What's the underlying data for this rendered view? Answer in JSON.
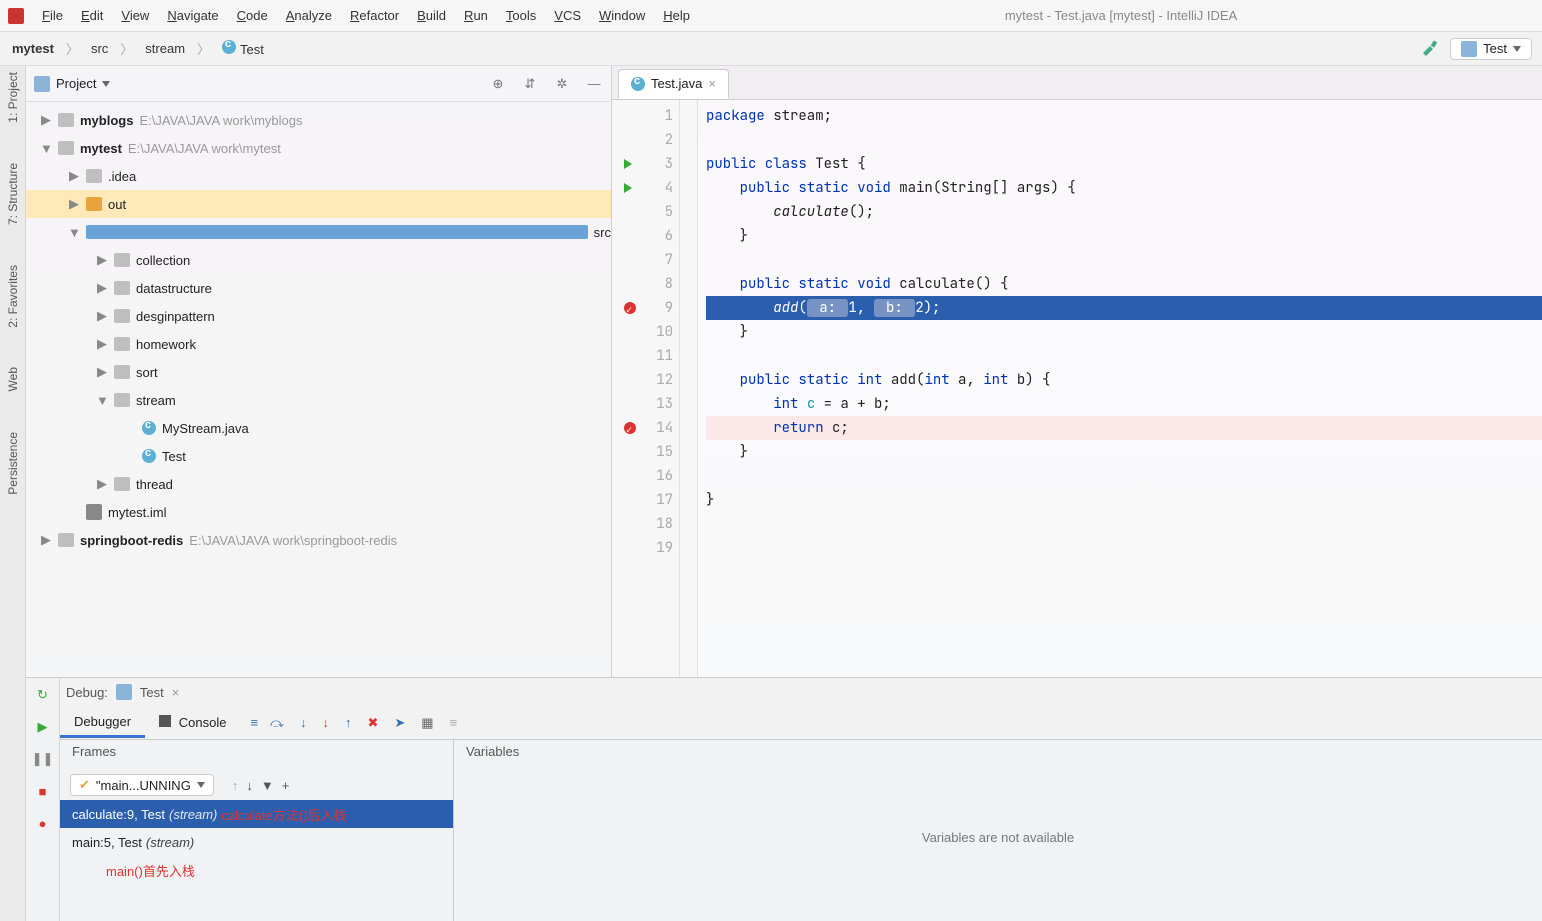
{
  "accent": "#2b5fae",
  "menubar": [
    "File",
    "Edit",
    "View",
    "Navigate",
    "Code",
    "Analyze",
    "Refactor",
    "Build",
    "Run",
    "Tools",
    "VCS",
    "Window",
    "Help"
  ],
  "window_title": "mytest - Test.java [mytest] - IntelliJ IDEA",
  "breadcrumb": [
    "mytest",
    "src",
    "stream",
    "Test"
  ],
  "run_config_label": "Test",
  "left_rail": [
    "1: Project",
    "7: Structure",
    "2: Favorites",
    "Web",
    "Persistence"
  ],
  "project_panel_title": "Project",
  "project_toolbar_icons": [
    "target-icon",
    "settings-down-icon",
    "gear-icon",
    "minimize-icon"
  ],
  "tree": [
    {
      "indent": 0,
      "tw": "▶",
      "kind": "folder",
      "label": "myblogs",
      "path": "E:\\JAVA\\JAVA work\\myblogs",
      "bold": true
    },
    {
      "indent": 0,
      "tw": "▼",
      "kind": "folder",
      "label": "mytest",
      "path": "E:\\JAVA\\JAVA work\\mytest",
      "bold": true
    },
    {
      "indent": 1,
      "tw": "▶",
      "kind": "folder",
      "label": ".idea"
    },
    {
      "indent": 1,
      "tw": "▶",
      "kind": "folder-out",
      "label": "out",
      "selected": true
    },
    {
      "indent": 1,
      "tw": "▼",
      "kind": "folder-src",
      "label": "src"
    },
    {
      "indent": 2,
      "tw": "▶",
      "kind": "folder",
      "label": "collection"
    },
    {
      "indent": 2,
      "tw": "▶",
      "kind": "folder",
      "label": "datastructure"
    },
    {
      "indent": 2,
      "tw": "▶",
      "kind": "folder",
      "label": "desginpattern"
    },
    {
      "indent": 2,
      "tw": "▶",
      "kind": "folder",
      "label": "homework"
    },
    {
      "indent": 2,
      "tw": "▶",
      "kind": "folder",
      "label": "sort"
    },
    {
      "indent": 2,
      "tw": "▼",
      "kind": "folder",
      "label": "stream"
    },
    {
      "indent": 3,
      "tw": "",
      "kind": "cfile",
      "label": "MyStream.java"
    },
    {
      "indent": 3,
      "tw": "",
      "kind": "cfile",
      "label": "Test"
    },
    {
      "indent": 2,
      "tw": "▶",
      "kind": "folder",
      "label": "thread"
    },
    {
      "indent": 1,
      "tw": "",
      "kind": "iml",
      "label": "mytest.iml"
    },
    {
      "indent": 0,
      "tw": "▶",
      "kind": "folder",
      "label": "springboot-redis",
      "path": "E:\\JAVA\\JAVA work\\springboot-redis",
      "bold": true
    }
  ],
  "editor_tab": "Test.java",
  "code_lines": [
    {
      "n": 1,
      "html": "<span class='kw'>package</span> stream;"
    },
    {
      "n": 2,
      "html": ""
    },
    {
      "n": 3,
      "html": "<span class='kw'>public class</span> Test {",
      "run": true
    },
    {
      "n": 4,
      "html": "    <span class='kw'>public static</span> <span class='kw'>void</span> <span class='fn'>main</span>(String[] args) {",
      "run": true
    },
    {
      "n": 5,
      "html": "        <span class='fni'>calculate</span>();"
    },
    {
      "n": 6,
      "html": "    }"
    },
    {
      "n": 7,
      "html": ""
    },
    {
      "n": 8,
      "html": "    <span class='kw'>public static</span> <span class='kw'>void</span> <span class='fn'>calculate</span>() {"
    },
    {
      "n": 9,
      "html": "        <span class='fni'>add</span>(<span class='hint'> a: </span>1, <span class='hint'> b: </span>2);",
      "hl": true,
      "bp": true
    },
    {
      "n": 10,
      "html": "    }"
    },
    {
      "n": 11,
      "html": ""
    },
    {
      "n": 12,
      "html": "    <span class='kw'>public static</span> <span class='kw'>int</span> <span class='fn'>add</span>(<span class='kw'>int</span> a, <span class='kw'>int</span> b) {"
    },
    {
      "n": 13,
      "html": "        <span class='kw'>int</span> <span class='ty'>c</span> = a + b;"
    },
    {
      "n": 14,
      "html": "        <span class='kw'>return</span> c;",
      "bp": true,
      "bpline": true
    },
    {
      "n": 15,
      "html": "    }"
    },
    {
      "n": 16,
      "html": ""
    },
    {
      "n": 17,
      "html": "}"
    },
    {
      "n": 18,
      "html": ""
    },
    {
      "n": 19,
      "html": ""
    }
  ],
  "debug": {
    "label": "Debug:",
    "tab": "Test",
    "tabs": [
      "Debugger",
      "Console"
    ],
    "frames_label": "Frames",
    "variables_label": "Variables",
    "thread": "\"main...UNNING",
    "frames": [
      {
        "text": "calculate:9, Test",
        "pkg": "(stream)",
        "anno": "calculate方法()后入栈",
        "sel": true
      },
      {
        "text": "main:5, Test",
        "pkg": "(stream)"
      }
    ],
    "anno2": "main()首先入栈",
    "vars_empty": "Variables are not available"
  }
}
